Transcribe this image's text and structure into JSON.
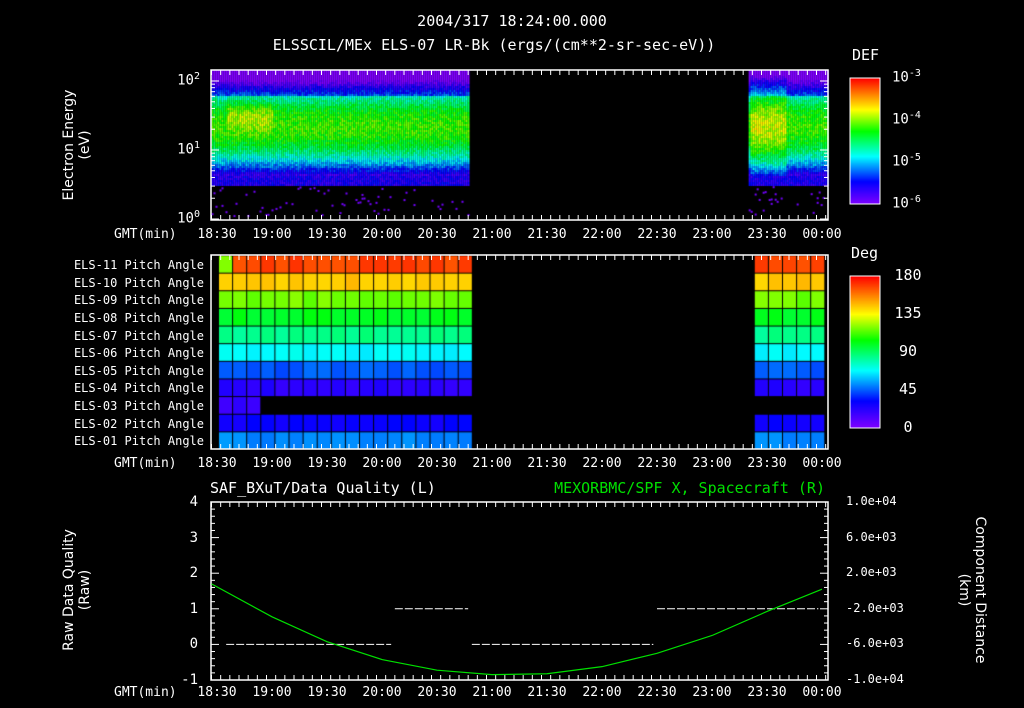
{
  "header": {
    "date_time": "2004/317 18:24:00.000"
  },
  "time_axis": {
    "label": "GMT(min)",
    "ticks": [
      "18:30",
      "19:00",
      "19:30",
      "20:00",
      "20:30",
      "21:00",
      "21:30",
      "22:00",
      "22:30",
      "23:00",
      "23:30",
      "00:00"
    ]
  },
  "chart_data": [
    {
      "type": "heatmap",
      "title": "ELSSCIL/MEx ELS-07 LR-Bk  (ergs/(cm**2-sr-sec-eV))",
      "ylabel": "Electron Energy",
      "yunit": "(eV)",
      "yscale": "log",
      "ylim": [
        1,
        140
      ],
      "yticks": [
        "10^0",
        "10^1",
        "10^2"
      ],
      "ytick_labels": [
        {
          "base": "10",
          "exp": "0"
        },
        {
          "base": "10",
          "exp": "1"
        },
        {
          "base": "10",
          "exp": "2"
        }
      ],
      "colorbar": {
        "label": "DEF",
        "scale": "log",
        "range": [
          1e-06,
          0.001
        ],
        "ticks": [
          {
            "base": "10",
            "exp": "-3"
          },
          {
            "base": "10",
            "exp": "-4"
          },
          {
            "base": "10",
            "exp": "-5"
          },
          {
            "base": "10",
            "exp": "-6"
          }
        ]
      },
      "data_intervals_minutes_from_1830": [
        [
          -3,
          137
        ],
        [
          290,
          333
        ]
      ],
      "peak_energy_eV": 30,
      "low_energy_cutoff_eV": 4
    },
    {
      "type": "heatmap",
      "title": "Pitch Angle",
      "rows": [
        "ELS-11 Pitch Angle",
        "ELS-10 Pitch Angle",
        "ELS-09 Pitch Angle",
        "ELS-08 Pitch Angle",
        "ELS-07 Pitch Angle",
        "ELS-06 Pitch Angle",
        "ELS-05 Pitch Angle",
        "ELS-04 Pitch Angle",
        "ELS-03 Pitch Angle",
        "ELS-02 Pitch Angle",
        "ELS-01 Pitch Angle"
      ],
      "row_values_deg": [
        168,
        145,
        118,
        100,
        85,
        68,
        45,
        22,
        18,
        30,
        52
      ],
      "els03_valid_until_minutes": 20,
      "colorbar": {
        "label": "Deg",
        "range": [
          0,
          180
        ],
        "ticks": [
          "180",
          "135",
          "90",
          "45",
          "0"
        ]
      },
      "data_intervals_minutes_from_1830": [
        [
          -3,
          137
        ],
        [
          290,
          333
        ]
      ]
    },
    {
      "type": "line",
      "title_left": "SAF_BXuT/Data Quality (L)",
      "title_right": "MEXORBMC/SPF X, Spacecraft (R)",
      "ylabel_left": "Raw Data Quality",
      "yunit_left": "(Raw)",
      "ylabel_right": "Component Distance",
      "yunit_right": "(km)",
      "ylim_left": [
        -1,
        4
      ],
      "yticks_left": [
        "4",
        "3",
        "2",
        "1",
        "0",
        "-1"
      ],
      "ylim_right": [
        -10000,
        10000
      ],
      "yticks_right": [
        "1.0e+04",
        "6.0e+03",
        "2.0e+03",
        "-2.0e+03",
        "-6.0e+03",
        "-1.0e+04"
      ],
      "series": [
        {
          "name": "Data Quality",
          "color": "#ffffff",
          "segments": [
            {
              "x": [
                5,
                95
              ],
              "y": 0
            },
            {
              "x": [
                97,
                137
              ],
              "y": 1
            },
            {
              "x": [
                139,
                238
              ],
              "y": 0
            },
            {
              "x": [
                240,
                328
              ],
              "y": 1
            }
          ]
        },
        {
          "name": "SPF X",
          "color": "#00e000",
          "x": [
            -3,
            30,
            60,
            90,
            120,
            150,
            180,
            210,
            240,
            270,
            300,
            330
          ],
          "y": [
            800,
            -2900,
            -5700,
            -7700,
            -8900,
            -9400,
            -9300,
            -8500,
            -7000,
            -5000,
            -2300,
            200
          ]
        }
      ]
    }
  ]
}
